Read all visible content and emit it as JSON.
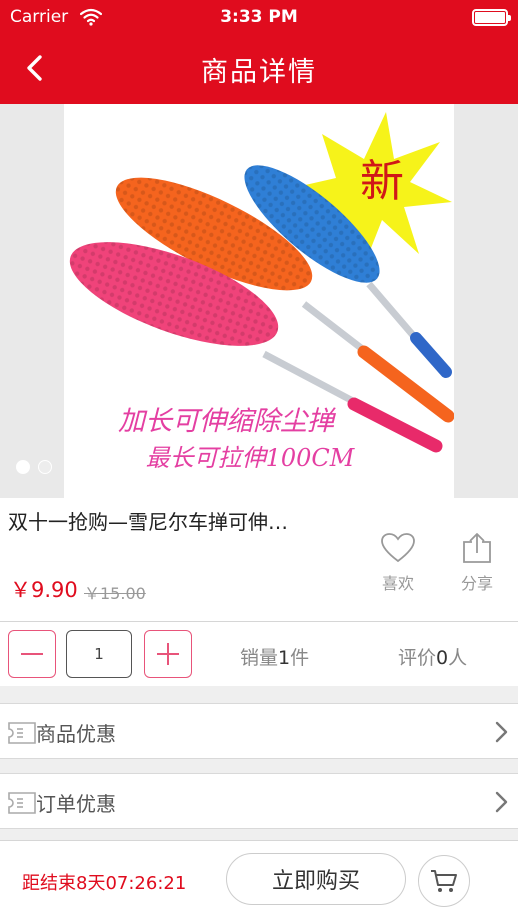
{
  "status_bar": {
    "carrier": "Carrier",
    "time": "3:33 PM"
  },
  "nav": {
    "title": "商品详情"
  },
  "gallery": {
    "badge": "新",
    "caption_line1": "加长可伸缩除尘掸",
    "caption_line2": "最长可拉伸100CM",
    "page_count": 2,
    "current_page": 1,
    "colors": {
      "pink": "#f0437a",
      "orange": "#f5641e",
      "blue": "#2f7fd6",
      "badge": "#f6f31a"
    }
  },
  "product": {
    "title": "双十一抢购—雪尼尔车掸可伸…",
    "price": "￥9.90",
    "original_price": "￥15.00",
    "favorite_label": "喜欢",
    "share_label": "分享"
  },
  "quantity": {
    "value": "1"
  },
  "stats": {
    "sales_prefix": "销量",
    "sales_count": "1",
    "sales_suffix": "件",
    "rating_prefix": "评价",
    "rating_count": "0",
    "rating_suffix": "人"
  },
  "rows": {
    "product_discount": "商品优惠",
    "order_discount": "订单优惠"
  },
  "bottom_bar": {
    "countdown": "距结束8天07:26:21",
    "buy_label": "立即购买"
  },
  "theme": {
    "primary": "#e00c1e",
    "accent_border": "#e8547a"
  }
}
